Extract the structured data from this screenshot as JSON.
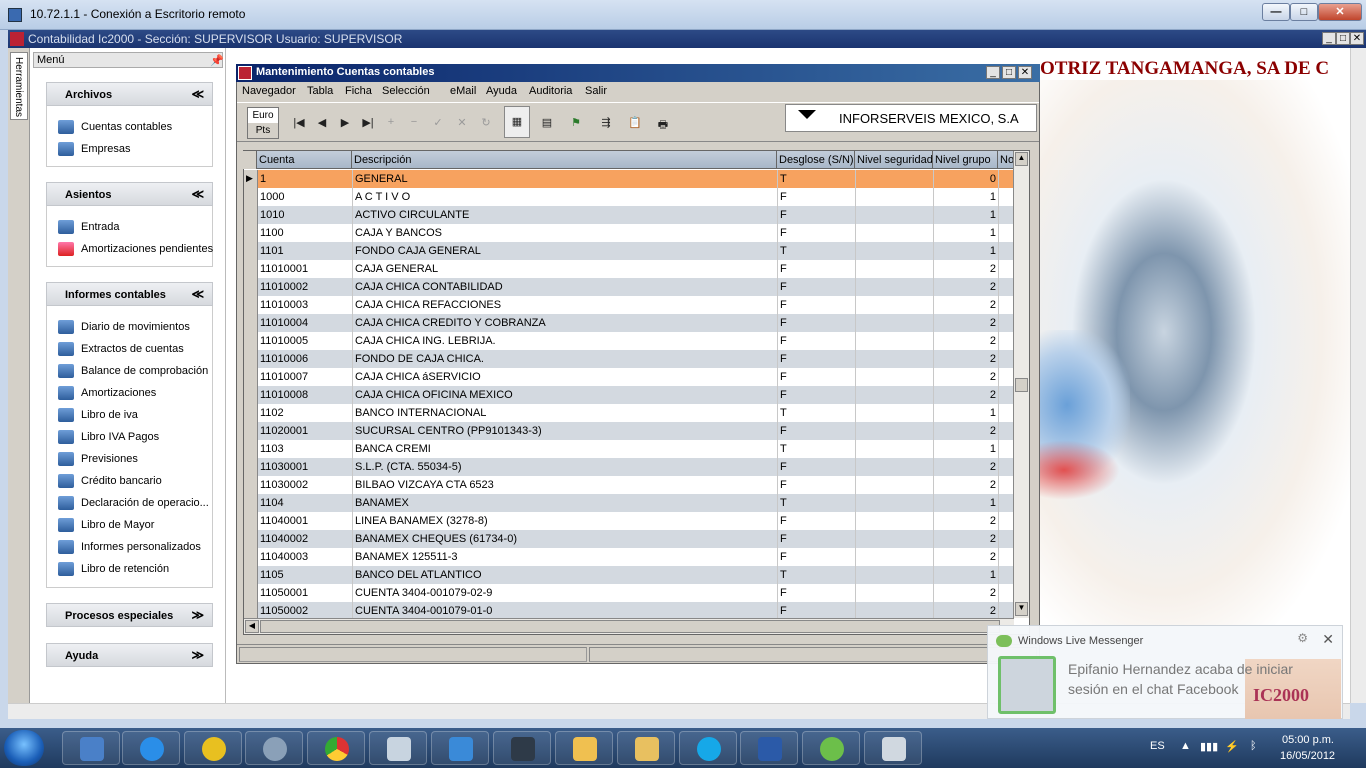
{
  "rdp": {
    "title": "10.72.1.1 - Conexión a Escritorio remoto",
    "min": "—",
    "max": "□",
    "close": "✕"
  },
  "app": {
    "title": "Contabilidad Ic2000   -   Sección: SUPERVISOR Usuario: SUPERVISOR",
    "min": "_",
    "max": "□",
    "close": "✕"
  },
  "sidebar": {
    "tab": "Herramientas",
    "menu_label": "Menú",
    "groups": [
      {
        "title": "Archivos",
        "chevron": "≪",
        "items": [
          "Cuentas contables",
          "Empresas"
        ]
      },
      {
        "title": "Asientos",
        "chevron": "≪",
        "items": [
          "Entrada",
          "Amortizaciones pendientes"
        ]
      },
      {
        "title": "Informes contables",
        "chevron": "≪",
        "items": [
          "Diario de movimientos",
          "Extractos de cuentas",
          "Balance de comprobación",
          "Amortizaciones",
          "Libro de iva",
          "Libro IVA Pagos",
          "Previsiones",
          "Crédito bancario",
          "Declaración de operacio...",
          "Libro de Mayor",
          "Informes personalizados",
          "Libro de retención"
        ]
      },
      {
        "title": "Procesos especiales",
        "chevron": "≫",
        "items": []
      },
      {
        "title": "Ayuda",
        "chevron": "≫",
        "items": []
      }
    ]
  },
  "company": "OTRIZ TANGAMANGA, SA DE C",
  "window": {
    "title": "Mantenimiento Cuentas contables",
    "menu": [
      "Navegador",
      "Tabla",
      "Ficha",
      "Selección",
      "eMail",
      "Ayuda",
      "Auditoria",
      "Salir"
    ],
    "euro": "Euro",
    "pts": "Pts",
    "toolbar": {
      "first": "|◀",
      "prev": "◀",
      "next": "▶",
      "last": "▶|",
      "insert": "+",
      "delete": "−",
      "post": "✓",
      "cancel": "✕",
      "refresh": "↻",
      "grid": "▦",
      "form": "▤",
      "filter": "⚑",
      "export": "⇶",
      "copy": "📋",
      "print": "🖶"
    },
    "segment": "INFORSERVEIS MEXICO, S.A",
    "columns": [
      "Cuenta",
      "Descripción",
      "Desglose (S/N)",
      "Nivel seguridad",
      "Nivel grupo",
      "No"
    ],
    "rows": [
      [
        "1",
        "GENERAL",
        "T",
        "",
        "0"
      ],
      [
        "1000",
        "A C T I V O",
        "F",
        "",
        "1"
      ],
      [
        "1010",
        "ACTIVO CIRCULANTE",
        "F",
        "",
        "1"
      ],
      [
        "1100",
        "CAJA Y BANCOS",
        "F",
        "",
        "1"
      ],
      [
        "1101",
        "FONDO CAJA GENERAL",
        "T",
        "",
        "1"
      ],
      [
        "11010001",
        "CAJA GENERAL",
        "F",
        "",
        "2"
      ],
      [
        "11010002",
        "CAJA CHICA CONTABILIDAD",
        "F",
        "",
        "2"
      ],
      [
        "11010003",
        "CAJA CHICA REFACCIONES",
        "F",
        "",
        "2"
      ],
      [
        "11010004",
        "CAJA CHICA CREDITO Y COBRANZA",
        "F",
        "",
        "2"
      ],
      [
        "11010005",
        "CAJA CHICA ING. LEBRIJA.",
        "F",
        "",
        "2"
      ],
      [
        "11010006",
        "FONDO DE CAJA CHICA.",
        "F",
        "",
        "2"
      ],
      [
        "11010007",
        "CAJA CHICA áSERVICIO",
        "F",
        "",
        "2"
      ],
      [
        "11010008",
        "CAJA CHICA OFICINA MEXICO",
        "F",
        "",
        "2"
      ],
      [
        "1102",
        "BANCO INTERNACIONAL",
        "T",
        "",
        "1"
      ],
      [
        "11020001",
        "SUCURSAL CENTRO (PP9101343-3)",
        "F",
        "",
        "2"
      ],
      [
        "1103",
        "BANCA CREMI",
        "T",
        "",
        "1"
      ],
      [
        "11030001",
        "S.L.P. (CTA. 55034-5)",
        "F",
        "",
        "2"
      ],
      [
        "11030002",
        "BILBAO VIZCAYA CTA 6523",
        "F",
        "",
        "2"
      ],
      [
        "1104",
        "BANAMEX",
        "T",
        "",
        "1"
      ],
      [
        "11040001",
        "LINEA BANAMEX (3278-8)",
        "F",
        "",
        "2"
      ],
      [
        "11040002",
        "BANAMEX CHEQUES (61734-0)",
        "F",
        "",
        "2"
      ],
      [
        "11040003",
        "BANAMEX 125511-3",
        "F",
        "",
        "2"
      ],
      [
        "1105",
        "BANCO DEL ATLANTICO",
        "T",
        "",
        "1"
      ],
      [
        "11050001",
        "CUENTA 3404-001079-02-9",
        "F",
        "",
        "2"
      ],
      [
        "11050002",
        "CUENTA 3404-001079-01-0",
        "F",
        "",
        "2"
      ]
    ]
  },
  "notification": {
    "app": "Windows Live Messenger",
    "message": "Epifanio Hernandez acaba de iniciar sesión en el chat Facebook",
    "gear": "⚙",
    "close": "✕",
    "logo": "IC2000"
  },
  "taskbar": {
    "lang": "ES",
    "time": "05:00 p.m.",
    "date": "16/05/2012",
    "apps": [
      "remote-desktop",
      "internet-explorer",
      "app-ic2000",
      "settings",
      "chrome",
      "calculator",
      "media-player",
      "network",
      "outlook",
      "explorer",
      "skype",
      "word",
      "messenger",
      "contacts"
    ]
  }
}
